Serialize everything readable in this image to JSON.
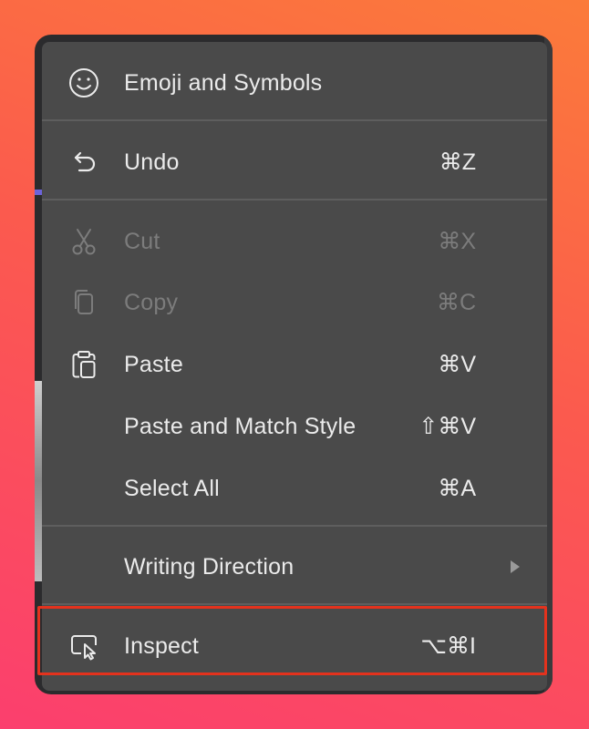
{
  "menu": {
    "items": [
      {
        "label": "Emoji and Symbols",
        "shortcut": "",
        "icon": "smiley-icon",
        "enabled": true
      },
      {
        "label": "Undo",
        "shortcut": "⌘Z",
        "icon": "undo-arrow-icon",
        "enabled": true
      },
      {
        "label": "Cut",
        "shortcut": "⌘X",
        "icon": "scissors-icon",
        "enabled": false
      },
      {
        "label": "Copy",
        "shortcut": "⌘C",
        "icon": "copy-icon",
        "enabled": false
      },
      {
        "label": "Paste",
        "shortcut": "⌘V",
        "icon": "clipboard-icon",
        "enabled": true
      },
      {
        "label": "Paste and Match Style",
        "shortcut": "⇧⌘V",
        "icon": "",
        "enabled": true
      },
      {
        "label": "Select All",
        "shortcut": "⌘A",
        "icon": "",
        "enabled": true
      },
      {
        "label": "Writing Direction",
        "shortcut": "",
        "icon": "",
        "enabled": true,
        "submenu": true
      },
      {
        "label": "Inspect",
        "shortcut": "⌥⌘I",
        "icon": "inspect-icon",
        "enabled": true,
        "highlighted": true
      }
    ]
  },
  "colors": {
    "menu_background": "#4a4a4a",
    "text": "#ebebeb",
    "disabled_text": "#7c7c7c",
    "highlight_border": "#e4321d"
  }
}
